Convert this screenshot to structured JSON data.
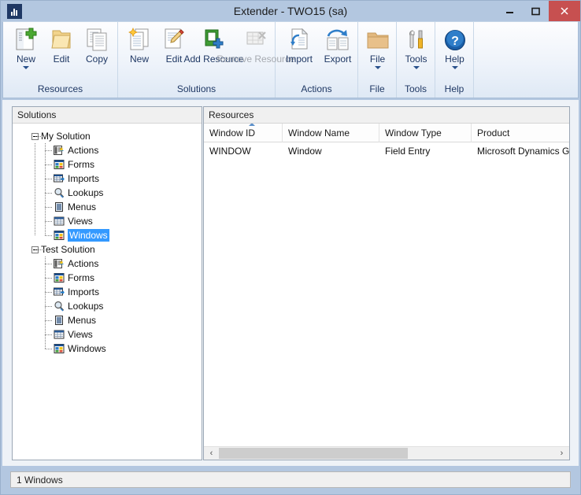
{
  "window": {
    "title": "Extender  -  TWO15 (sa)",
    "icon": "app-chart-icon",
    "controls": {
      "minimize": "–",
      "maximize": "☐",
      "close": "×"
    },
    "accent_titlebar": "#b3c7e0",
    "accent_close": "#c75050",
    "accent_selection": "#3399ff"
  },
  "ribbon": {
    "groups": [
      {
        "label": "Resources",
        "items": [
          {
            "label": "New",
            "icon": "new-document-plus-icon",
            "has_caret": true,
            "disabled": false
          },
          {
            "label": "Edit",
            "icon": "folder-open-icon",
            "has_caret": false,
            "disabled": false
          },
          {
            "label": "Copy",
            "icon": "copy-pages-icon",
            "has_caret": false,
            "disabled": false
          }
        ]
      },
      {
        "label": "Solutions",
        "items": [
          {
            "label": "New",
            "icon": "new-pages-star-icon",
            "has_caret": false,
            "disabled": false
          },
          {
            "label": "Edit",
            "icon": "page-pencil-icon",
            "has_caret": false,
            "disabled": false
          },
          {
            "label": "Add Resource",
            "icon": "add-resource-book-plus-icon",
            "has_caret": false,
            "disabled": false
          },
          {
            "label": "Remove Resource",
            "icon": "remove-resource-grid-x-icon",
            "has_caret": false,
            "disabled": true
          }
        ]
      },
      {
        "label": "Actions",
        "items": [
          {
            "label": "Import",
            "icon": "import-page-arrow-icon",
            "has_caret": false,
            "disabled": false
          },
          {
            "label": "Export",
            "icon": "export-pages-arrow-icon",
            "has_caret": false,
            "disabled": false
          }
        ]
      },
      {
        "label": "File",
        "items": [
          {
            "label": "File",
            "icon": "folder-icon",
            "has_caret": true,
            "disabled": false
          }
        ]
      },
      {
        "label": "Tools",
        "items": [
          {
            "label": "Tools",
            "icon": "wrench-screwdriver-icon",
            "has_caret": true,
            "disabled": false
          }
        ]
      },
      {
        "label": "Help",
        "items": [
          {
            "label": "Help",
            "icon": "help-question-icon",
            "has_caret": true,
            "disabled": false
          }
        ]
      }
    ]
  },
  "solutions_panel": {
    "header": "Solutions",
    "tree": [
      {
        "label": "My Solution",
        "icon": "expander-minus-icon",
        "expanded": true,
        "children": [
          {
            "label": "Actions",
            "icon": "actions-icon"
          },
          {
            "label": "Forms",
            "icon": "forms-icon"
          },
          {
            "label": "Imports",
            "icon": "imports-icon"
          },
          {
            "label": "Lookups",
            "icon": "lookups-icon"
          },
          {
            "label": "Menus",
            "icon": "menus-icon"
          },
          {
            "label": "Views",
            "icon": "views-icon"
          },
          {
            "label": "Windows",
            "icon": "windows-icon",
            "selected": true
          }
        ]
      },
      {
        "label": "Test Solution",
        "icon": "expander-minus-icon",
        "expanded": true,
        "children": [
          {
            "label": "Actions",
            "icon": "actions-icon"
          },
          {
            "label": "Forms",
            "icon": "forms-icon"
          },
          {
            "label": "Imports",
            "icon": "imports-icon"
          },
          {
            "label": "Lookups",
            "icon": "lookups-icon"
          },
          {
            "label": "Menus",
            "icon": "menus-icon"
          },
          {
            "label": "Views",
            "icon": "views-icon"
          },
          {
            "label": "Windows",
            "icon": "windows-icon"
          }
        ]
      }
    ]
  },
  "resources_panel": {
    "header": "Resources",
    "columns": [
      {
        "label": "Window ID",
        "sorted": "ascending"
      },
      {
        "label": "Window Name",
        "sorted": ""
      },
      {
        "label": "Window Type",
        "sorted": ""
      },
      {
        "label": "Product",
        "sorted": ""
      }
    ],
    "rows": [
      {
        "window_id": "WINDOW",
        "window_name": "Window",
        "window_type": "Field Entry",
        "product": "Microsoft Dynamics GP"
      }
    ],
    "scrollbar": {
      "left_arrow": "‹",
      "right_arrow": "›"
    }
  },
  "statusbar": {
    "text": "1 Windows"
  }
}
